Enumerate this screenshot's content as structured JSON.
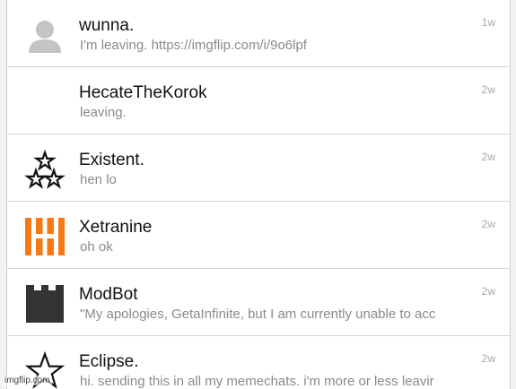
{
  "chats": [
    {
      "name": "wunna.",
      "message": "I'm leaving. https://imgflip.com/i/9o6lpf",
      "time": "1w",
      "avatar_icon": "default-user-icon"
    },
    {
      "name": "HecateTheKorok",
      "message": "leaving.",
      "time": "2w",
      "avatar_icon": "blank"
    },
    {
      "name": "Existent.",
      "message": "hen lo",
      "time": "2w",
      "avatar_icon": "three-stars-icon"
    },
    {
      "name": "Xetranine",
      "message": "oh ok",
      "time": "2w",
      "avatar_icon": "orange-h-logo-icon"
    },
    {
      "name": "ModBot",
      "message": "\"My apologies, GetaInfinite, but I am currently unable to acc",
      "time": "2w",
      "avatar_icon": "castle-tower-icon"
    },
    {
      "name": "Eclipse.",
      "message": "hi. sending this in all my memechats. i'm more or less leavir",
      "time": "2w",
      "avatar_icon": "star-outline-icon"
    }
  ],
  "watermark": "imgflip.com",
  "colors": {
    "orange_logo": "#f57a15",
    "dark_icon": "#333333"
  }
}
